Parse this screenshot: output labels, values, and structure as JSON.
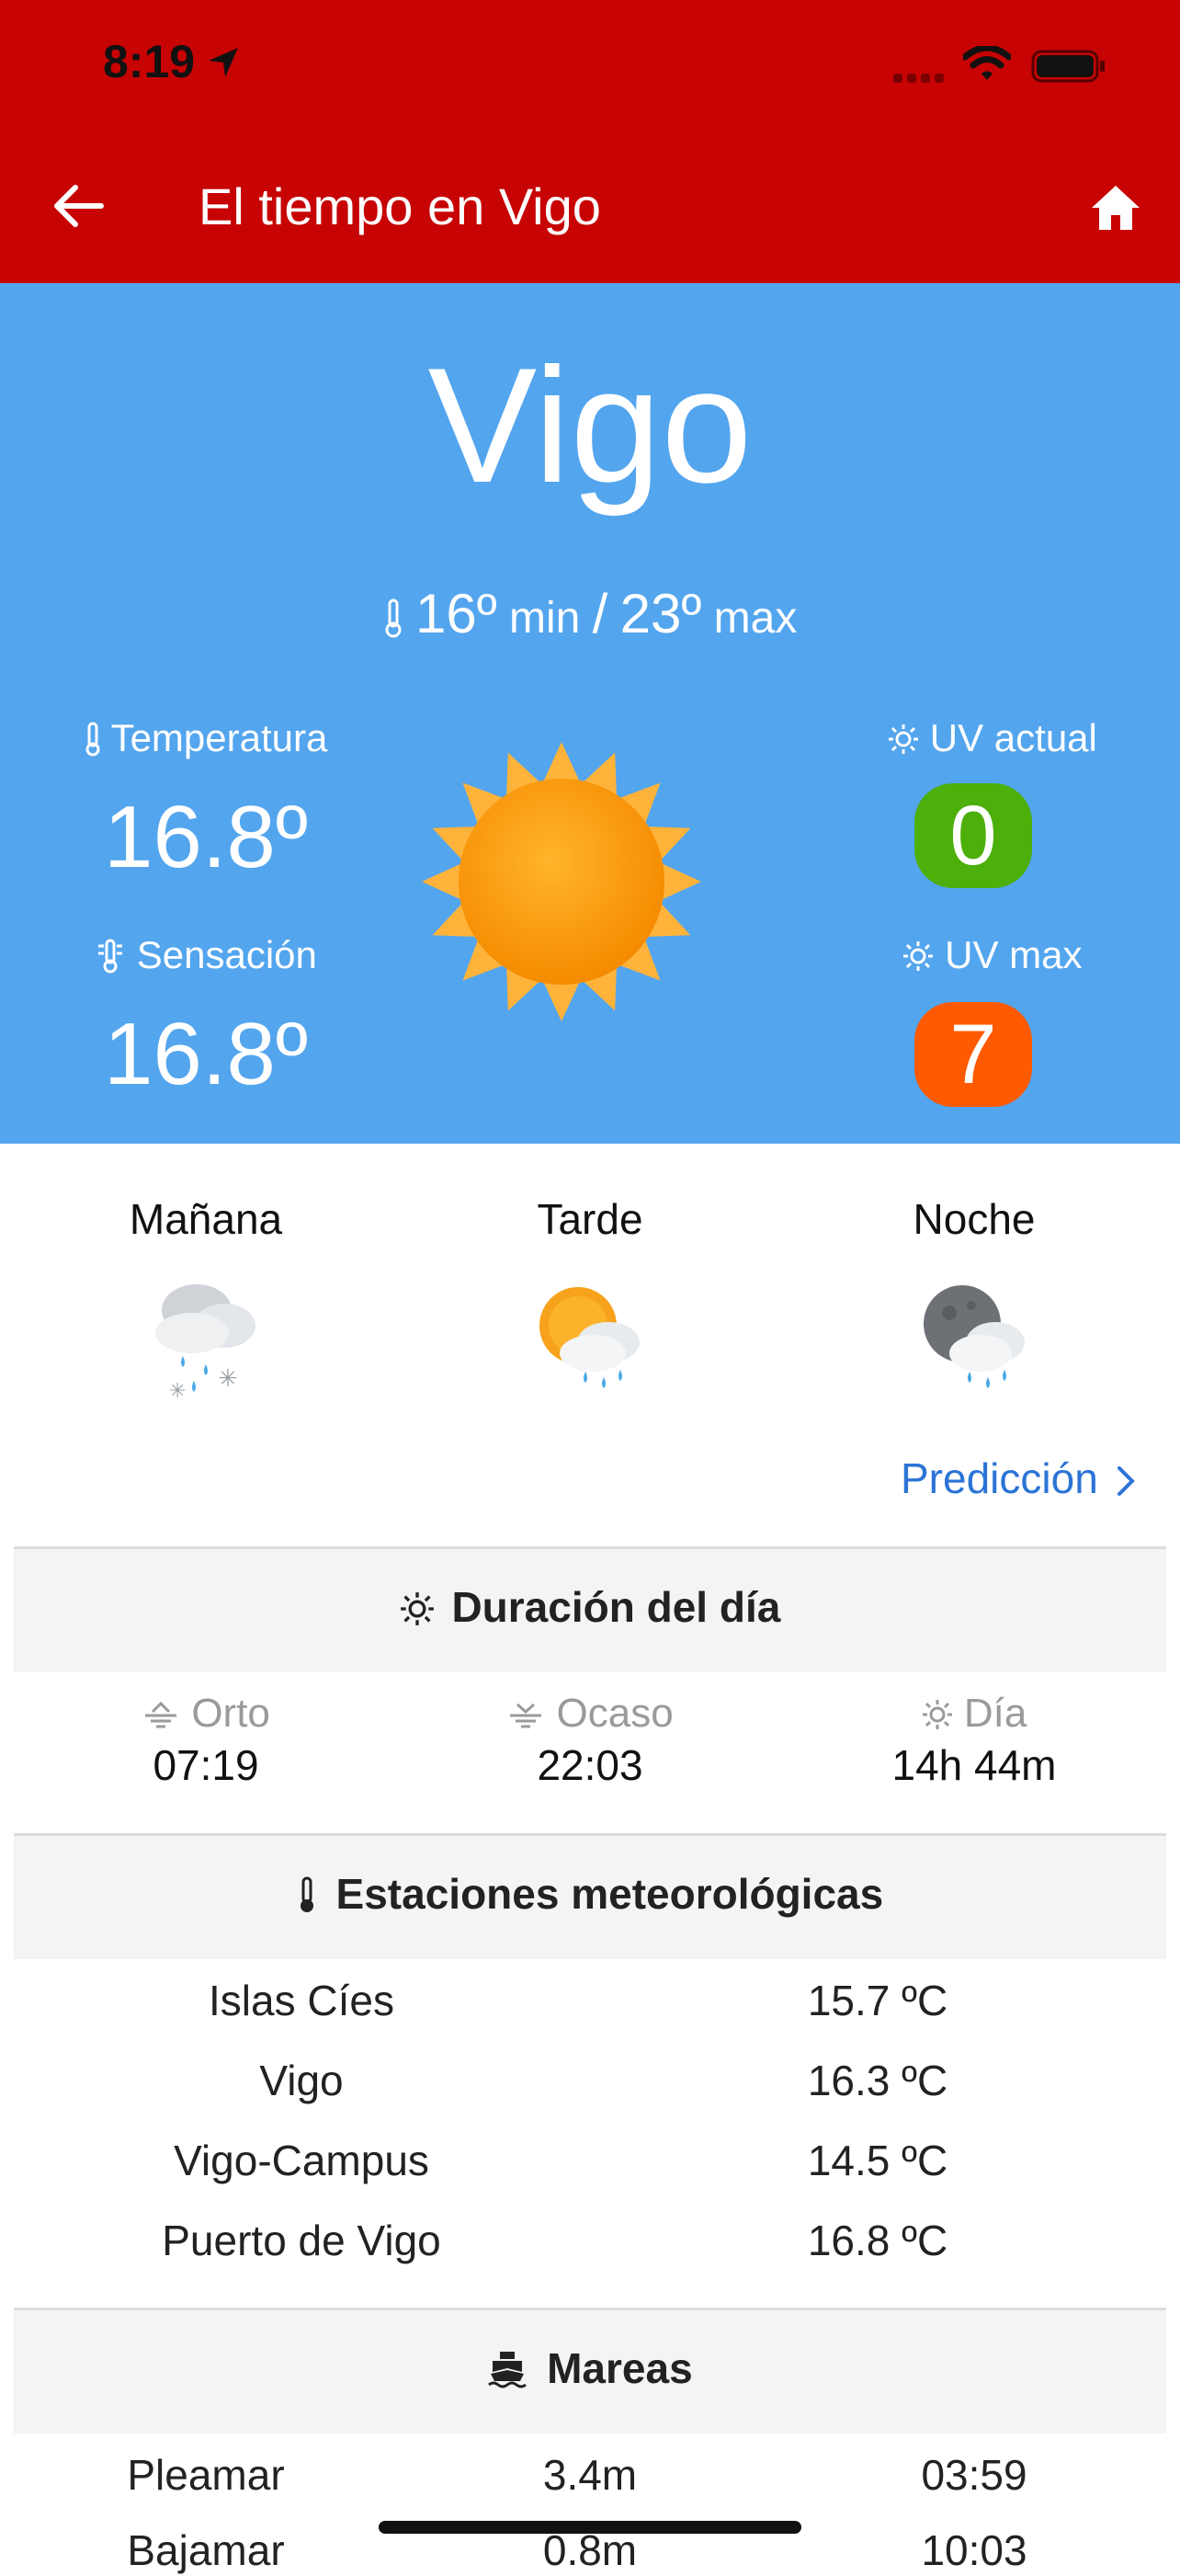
{
  "status_bar": {
    "time": "8:19"
  },
  "nav": {
    "title": "El tiempo en Vigo"
  },
  "hero": {
    "city": "Vigo",
    "min_value": "16º",
    "min_label": "min",
    "separator": "/",
    "max_value": "23º",
    "max_label": "max",
    "temperature_label": "Temperatura",
    "temperature_value": "16.8º",
    "feels_label": "Sensación",
    "feels_value": "16.8º",
    "uv_current_label": "UV actual",
    "uv_current_value": "0",
    "uv_max_label": "UV max",
    "uv_max_value": "7",
    "colors": {
      "background": "#53a5ee",
      "uv_current": "#4caf0a",
      "uv_max": "#ff5a00"
    }
  },
  "day_parts": [
    {
      "label": "Mañana",
      "icon": "cloud-rain-snow-icon"
    },
    {
      "label": "Tarde",
      "icon": "sun-cloud-rain-icon"
    },
    {
      "label": "Noche",
      "icon": "moon-cloud-rain-icon"
    }
  ],
  "prediction_link": "Predicción",
  "day_duration": {
    "title": "Duración del día",
    "items": [
      {
        "label": "Orto",
        "value": "07:19",
        "icon": "sunrise-icon"
      },
      {
        "label": "Ocaso",
        "value": "22:03",
        "icon": "sunset-icon"
      },
      {
        "label": "Día",
        "value": "14h 44m",
        "icon": "sun-icon"
      }
    ]
  },
  "stations": {
    "title": "Estaciones meteorológicas",
    "rows": [
      {
        "name": "Islas Cíes",
        "temp": "15.7 ºC"
      },
      {
        "name": "Vigo",
        "temp": "16.3 ºC"
      },
      {
        "name": "Vigo-Campus",
        "temp": "14.5 ºC"
      },
      {
        "name": "Puerto de Vigo",
        "temp": "16.8 ºC"
      }
    ]
  },
  "tides": {
    "title": "Mareas",
    "rows": [
      {
        "type": "Pleamar",
        "height": "3.4m",
        "time": "03:59"
      },
      {
        "type": "Bajamar",
        "height": "0.8m",
        "time": "10:03"
      }
    ]
  },
  "brand_color": "#c70303"
}
